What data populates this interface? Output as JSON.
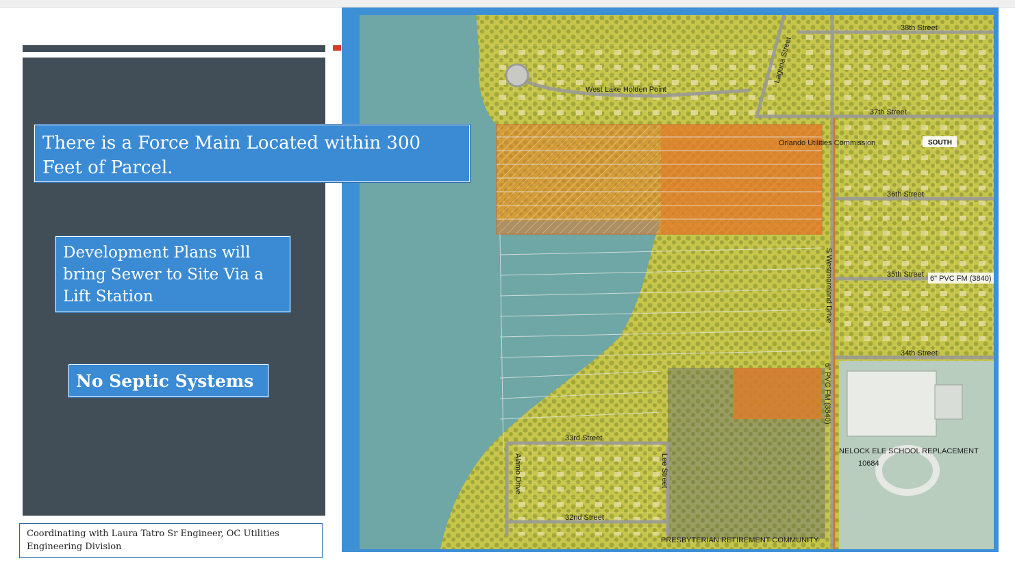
{
  "callouts": {
    "force_main": "There is a Force Main Located within 300 Feet of Parcel.",
    "development_plans": "Development  Plans will bring Sewer to Site Via a Lift Station",
    "no_septic": "No Septic Systems"
  },
  "footnote": "Coordinating with Laura Tatro Sr Engineer, OC Utilities Engineering Division",
  "map": {
    "streets": {
      "street_38": "38th Street",
      "street_37": "37th Street",
      "street_36": "36th Street",
      "street_35": "35th Street",
      "street_34": "34th Street",
      "street_33": "33rd Street",
      "street_32": "32nd Street",
      "laguna": "Laguna Street",
      "west_lake_holden": "West Lake Holden Point",
      "westmoreland": "S Westmoreland Drive",
      "alamo": "Alamo Drive",
      "lee": "Lee Street"
    },
    "annotations": {
      "orlando_utilities": "Orlando Utilities Commission",
      "south": "SOUTH",
      "pvc_fm_east": "6\" PVC FM (3840)",
      "pvc_fm_vertical": "6\" PVC FM (3840)",
      "school": "NELOCK ELE SCHOOL REPLACEMENT",
      "school_code": "10684",
      "retirement": "PRESBYTERIAN RETIREMENT COMMUNITY"
    },
    "colors": {
      "lake": "#6fa6a6",
      "land": "#c7c64a",
      "parcel": "#e07c2a",
      "frame": "#3d8fd6"
    }
  }
}
